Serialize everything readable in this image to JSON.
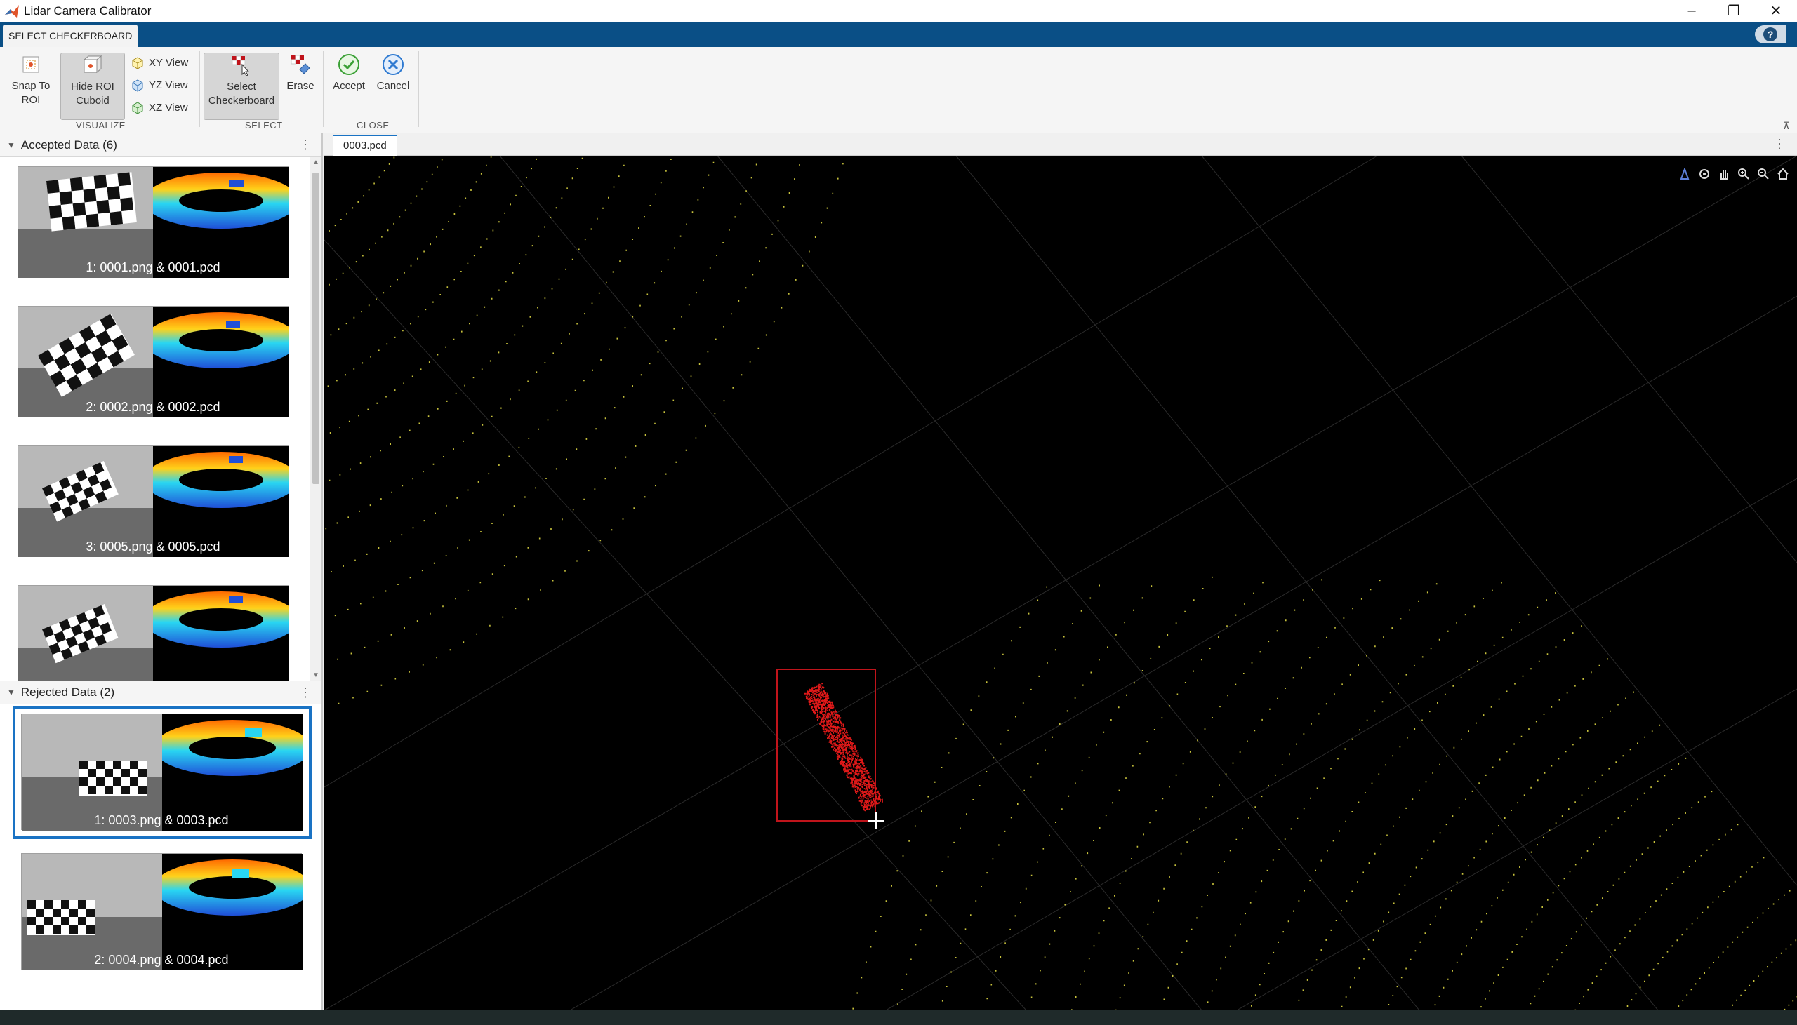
{
  "window": {
    "title": "Lidar Camera Calibrator"
  },
  "ribbon_tab": {
    "label": "SELECT CHECKERBOARD"
  },
  "ribbon": {
    "snap_to_roi": "Snap To ROI",
    "hide_roi_cuboid": "Hide ROI Cuboid",
    "xy_view": "XY View",
    "yz_view": "YZ View",
    "xz_view": "XZ View",
    "select_checkerboard": "Select Checkerboard",
    "erase": "Erase",
    "accept": "Accept",
    "cancel": "Cancel",
    "groups": {
      "visualize": "VISUALIZE",
      "select": "SELECT",
      "close": "CLOSE"
    }
  },
  "accepted": {
    "title": "Accepted Data (6)",
    "items": [
      {
        "caption": "1: 0001.png & 0001.pcd"
      },
      {
        "caption": "2: 0002.png & 0002.pcd"
      },
      {
        "caption": "3: 0005.png & 0005.pcd"
      },
      {
        "caption": ""
      }
    ]
  },
  "rejected": {
    "title": "Rejected Data (2)",
    "items": [
      {
        "caption": "1: 0003.png & 0003.pcd",
        "selected": true
      },
      {
        "caption": "2: 0004.png & 0004.pcd"
      }
    ]
  },
  "document": {
    "tab": "0003.pcd"
  },
  "colors": {
    "accent": "#1a73c4",
    "ribbon_band": "#0a4f86",
    "roi_box": "#c0141b",
    "points_selected": "#e11919",
    "points_scan": "#c8c23c"
  },
  "icons": [
    "matlab-icon",
    "snap-icon",
    "cuboid-icon",
    "xy-view-icon",
    "yz-view-icon",
    "xz-view-icon",
    "select-icon",
    "erase-icon",
    "accept-icon",
    "cancel-icon",
    "help-icon",
    "rotate-icon",
    "pan-icon",
    "zoom-in-icon",
    "zoom-out-icon",
    "home-icon"
  ]
}
